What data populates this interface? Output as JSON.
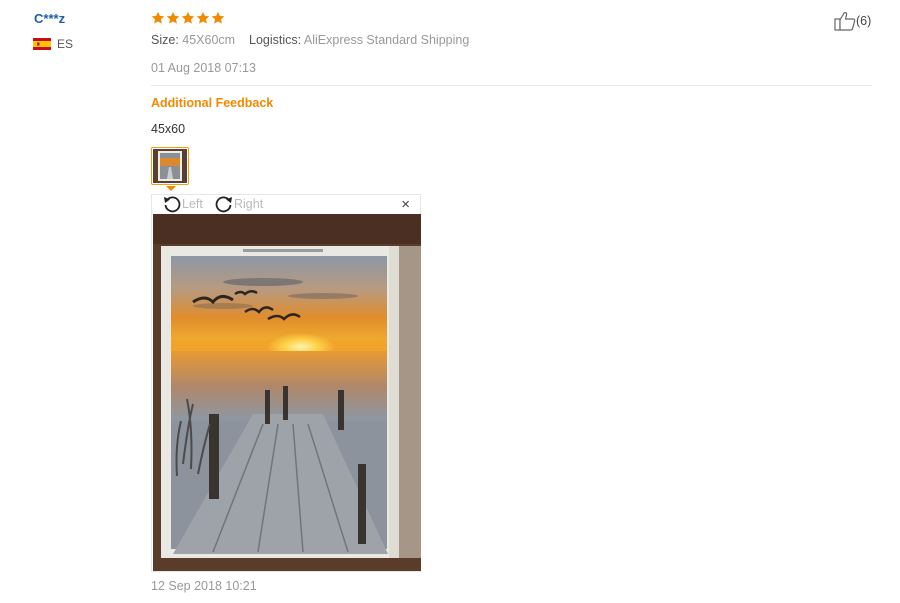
{
  "reviewer": {
    "name": "C***z",
    "country_code": "ES",
    "flag_icon": "spain-flag-icon"
  },
  "rating": {
    "stars": 5,
    "max": 5,
    "color": "#f08a00"
  },
  "order": {
    "size_label": "Size:",
    "size_value": "45X60cm",
    "logistics_label": "Logistics:",
    "logistics_value": "AliExpress Standard Shipping"
  },
  "review_date": "01 Aug 2018 07:13",
  "helpful": {
    "count_text": "(6)",
    "icon": "thumbs-up-icon"
  },
  "additional_feedback": {
    "title": "Additional Feedback",
    "text": "45x60",
    "date": "12 Sep 2018 10:21"
  },
  "image_viewer": {
    "rotate_left_label": "Left",
    "rotate_right_label": "Right",
    "close_symbol": "×",
    "accent": "#f08a00"
  }
}
